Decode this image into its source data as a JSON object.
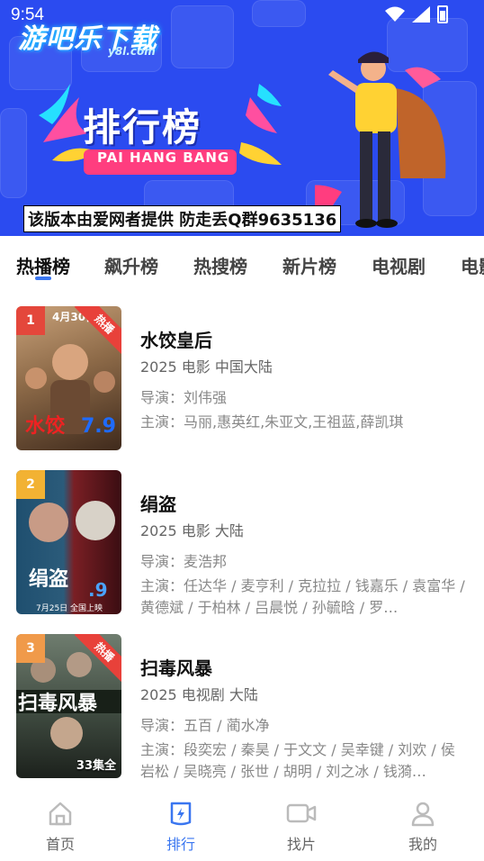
{
  "status_bar": {
    "time": "9:54"
  },
  "banner": {
    "logo": "游吧乐下载",
    "logo_sub": "y8l.com",
    "title": "排行榜",
    "subtitle": "PAI HANG BANG",
    "notice": "该版本由爱网者提供 防走丢Q群9635136",
    "colors": {
      "background": "#2b4bf0"
    }
  },
  "tabs": [
    {
      "label": "热播榜",
      "active": true
    },
    {
      "label": "飙升榜"
    },
    {
      "label": "热搜榜"
    },
    {
      "label": "新片榜"
    },
    {
      "label": "电视剧"
    },
    {
      "label": "电影"
    }
  ],
  "list": [
    {
      "rank": "1",
      "rank_color": "#e4473b",
      "badge": "热播",
      "title": "水饺皇后",
      "meta": "2025  电影  中国大陆",
      "director": "导演：刘伟强",
      "cast": "主演：马丽,惠英红,朱亚文,王祖蓝,薛凯琪",
      "poster_colors": [
        "#b78c62",
        "#5a3b26"
      ]
    },
    {
      "rank": "2",
      "rank_color": "#f2b233",
      "title": "绢盗",
      "meta": "2025  电影  大陆",
      "director": "导演：麦浩邦",
      "cast": "主演：任达华 / 麦亨利 / 克拉拉 / 钱嘉乐 / 袁富华 / 黄德斌 / 于柏林 / 吕晨悦 / 孙毓晗 / 罗…",
      "poster_colors": [
        "#2a5a78",
        "#8a1d22"
      ]
    },
    {
      "rank": "3",
      "rank_color": "#f09a4a",
      "badge": "热播",
      "episodes": "33集全",
      "title": "扫毒风暴",
      "meta": "2025  电视剧  大陆",
      "director": "导演：五百 / 蔺水净",
      "cast": "主演：段奕宏 / 秦昊 / 于文文 / 吴幸键 / 刘欢 / 侯岩松 / 吴晓亮 / 张世 / 胡明 / 刘之冰 / 钱漪…",
      "poster_colors": [
        "#5b6a5c",
        "#222a24"
      ]
    }
  ],
  "bottom_nav": [
    {
      "label": "首页",
      "icon": "home-icon"
    },
    {
      "label": "排行",
      "icon": "ranking-icon",
      "active": true
    },
    {
      "label": "找片",
      "icon": "video-camera-icon"
    },
    {
      "label": "我的",
      "icon": "user-icon"
    }
  ]
}
